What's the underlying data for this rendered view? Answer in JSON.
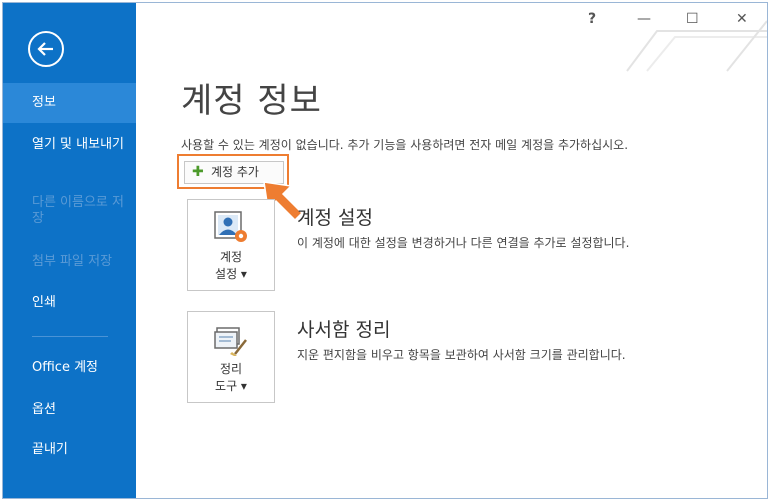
{
  "window": {
    "help_glyph": "?",
    "minimize_glyph": "—",
    "maximize_glyph": "☐",
    "close_glyph": "✕"
  },
  "sidebar": {
    "items": [
      {
        "label": "정보",
        "state": "active"
      },
      {
        "label": "열기 및 내보내기",
        "state": "normal"
      },
      {
        "label": "다른 이름으로 저장",
        "state": "disabled"
      },
      {
        "label": "첨부 파일 저장",
        "state": "disabled"
      },
      {
        "label": "인쇄",
        "state": "normal"
      },
      {
        "label": "Office 계정",
        "state": "normal"
      },
      {
        "label": "옵션",
        "state": "normal"
      },
      {
        "label": "끝내기",
        "state": "normal"
      }
    ]
  },
  "main": {
    "title": "계정 정보",
    "info_text": "사용할 수 있는 계정이 없습니다. 추가 기능을 사용하려면 전자 메일 계정을 추가하십시오.",
    "add_account_label": "계정 추가",
    "sections": [
      {
        "card_line1": "계정",
        "card_line2": "설정 ▾",
        "title": "계정 설정",
        "description": "이 계정에 대한 설정을 변경하거나 다른 연결을 추가로 설정합니다."
      },
      {
        "card_line1": "정리",
        "card_line2": "도구 ▾",
        "title": "사서함 정리",
        "description": "지운 편지함을 비우고 항목을 보관하여 사서함 크기를 관리합니다."
      }
    ]
  },
  "colors": {
    "sidebar": "#0d72c7",
    "sidebar_active": "#2b88d8",
    "highlight": "#ee7d31",
    "plus": "#4c9a2a"
  },
  "icons": [
    "back-arrow-icon",
    "plus-icon",
    "account-settings-icon",
    "cleanup-tools-icon"
  ]
}
